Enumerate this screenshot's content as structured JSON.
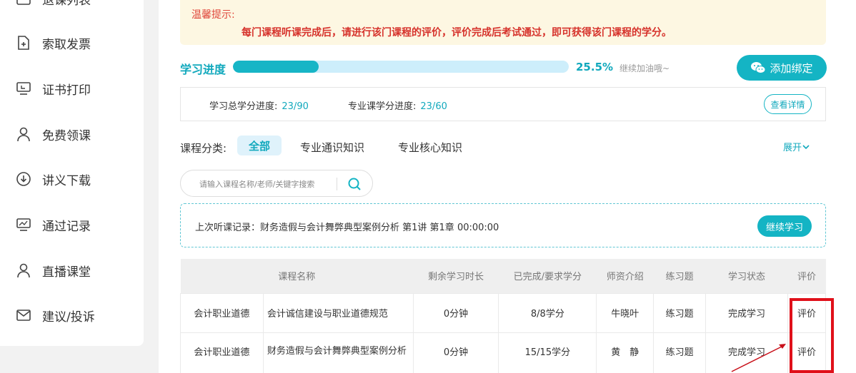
{
  "sidebar": {
    "items": [
      {
        "label": "退课列表",
        "icon": "list-icon"
      },
      {
        "label": "索取发票",
        "icon": "invoice-icon"
      },
      {
        "label": "证书打印",
        "icon": "monitor-icon"
      },
      {
        "label": "免费领课",
        "icon": "user-icon"
      },
      {
        "label": "讲义下载",
        "icon": "download-icon"
      },
      {
        "label": "通过记录",
        "icon": "chart-icon"
      },
      {
        "label": "直播课堂",
        "icon": "user-icon"
      },
      {
        "label": "建议/投诉",
        "icon": "mail-icon"
      }
    ]
  },
  "notice": {
    "title": "温馨提示:",
    "text": "每门课程听课完成后，请进行该门课程的评价，评价完成后考试通过，即可获得该门课程的学分。"
  },
  "progress": {
    "label": "学习进度",
    "percent_text": "25.5%",
    "fraction": 0.255,
    "encourage": "继续加油哦~",
    "bind_button": "添加绑定"
  },
  "credits": {
    "total_label": "学习总学分进度:",
    "total_value": "23/90",
    "major_label": "专业课学分进度:",
    "major_value": "23/60",
    "detail_button": "查看详情"
  },
  "categories": {
    "label": "课程分类:",
    "items": [
      "全部",
      "专业通识知识",
      "专业核心知识"
    ],
    "expand": "展开"
  },
  "search": {
    "placeholder": "请输入课程名称/老师/关键字搜索"
  },
  "last_record": {
    "text": "上次听课记录：财务造假与会计舞弊典型案例分析 第1讲 第1章 00:00:00",
    "continue_button": "继续学习"
  },
  "table": {
    "headers": [
      "课程名称",
      "剩余学习时长",
      "已完成/要求学分",
      "师资介绍",
      "练习题",
      "学习状态",
      "评价"
    ],
    "rows": [
      {
        "category": "会计职业道德",
        "name": "会计诚信建设与职业道德规范",
        "remaining": "0分钟",
        "credits": "8/8学分",
        "teacher": "牛晓叶",
        "exercise": "练习题",
        "status": "完成学习",
        "eval": "评价"
      },
      {
        "category": "会计职业道德",
        "name": "财务造假与会计舞弊典型案例分析",
        "remaining": "0分钟",
        "credits": "15/15学分",
        "teacher": "黄　静",
        "exercise": "练习题",
        "status": "完成学习",
        "eval": "评价"
      }
    ]
  },
  "colors": {
    "accent": "#14b4c4",
    "notice_text": "#d6322b",
    "highlight": "#e0101a"
  }
}
